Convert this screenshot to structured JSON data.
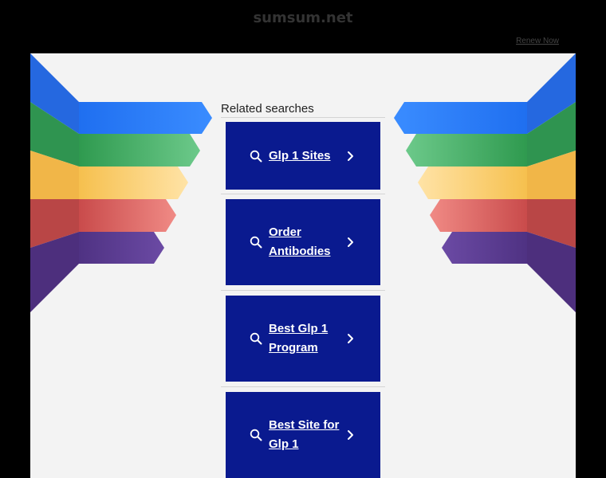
{
  "site": {
    "domain": "sumsum.net",
    "renew_label": "Renew Now"
  },
  "related": {
    "heading": "Related searches",
    "items": [
      {
        "label": "Glp 1 Sites"
      },
      {
        "label": "Order Antibodies"
      },
      {
        "label": "Best Glp 1 Program"
      },
      {
        "label": "Best Site for Glp 1"
      }
    ]
  },
  "icons": {
    "search": "search-icon",
    "chevron": "chevron-right-icon"
  },
  "colors": {
    "card_bg": "#0a1a8f",
    "ribbon_blue": "#2d7cf7",
    "ribbon_green": "#3aa65a",
    "ribbon_yellow": "#fbd06a",
    "ribbon_red": "#d9595a",
    "ribbon_purple": "#5c3a8f"
  }
}
